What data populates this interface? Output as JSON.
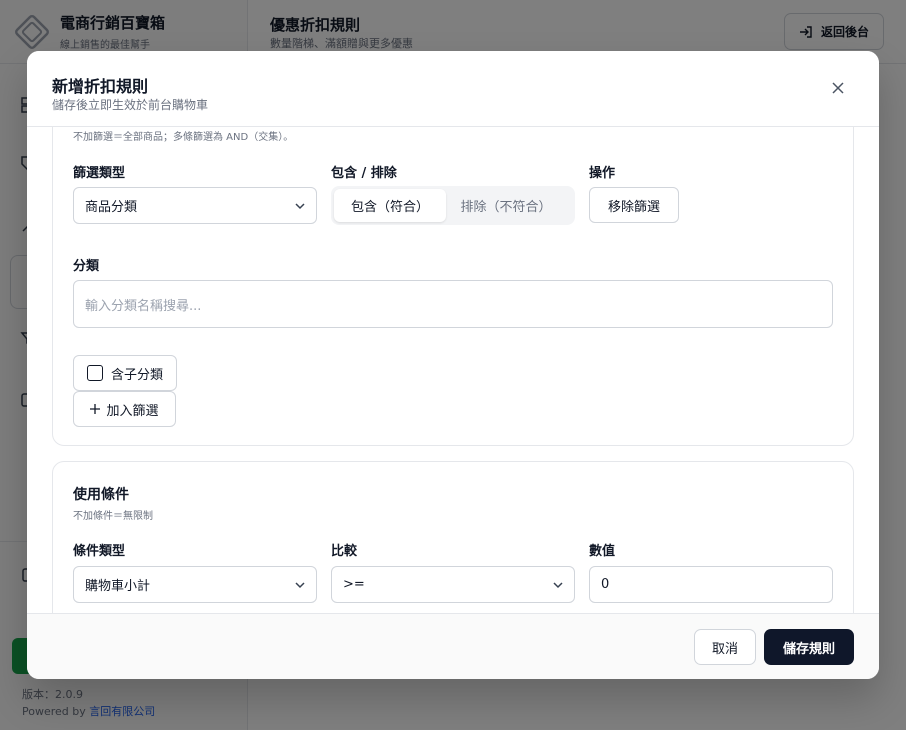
{
  "app": {
    "brand_title": "電商行銷百寶箱",
    "brand_subtitle": "線上銷售的最佳幫手",
    "page_title": "優惠折扣規則",
    "page_subtitle": "數量階梯、滿額贈與更多優惠",
    "back_button": "返回後台",
    "version": "版本：2.0.9",
    "powered_prefix": "Powered by ",
    "powered_company": "言回有限公司"
  },
  "modal": {
    "title": "新增折扣規則",
    "subtitle": "儲存後立即生效於前台購物車",
    "filters_hint": "不加篩選＝全部商品；多條篩選為 AND（交集）。",
    "filter_type_label": "篩選類型",
    "filter_type_value": "商品分類",
    "include_exclude_label": "包含 / 排除",
    "include_option": "包含（符合）",
    "exclude_option": "排除（不符合）",
    "actions_label": "操作",
    "remove_filter_button": "移除篩選",
    "category_label": "分類",
    "category_placeholder": "輸入分類名稱搜尋...",
    "include_children_label": "含子分類",
    "add_filter_button": "加入篩選",
    "conditions_title": "使用條件",
    "conditions_hint": "不加條件＝無限制",
    "condition_type_label": "條件類型",
    "condition_type_value": "購物車小計",
    "compare_label": "比較",
    "compare_value": ">=",
    "value_label": "數值",
    "value_value": "0",
    "cancel_button": "取消",
    "save_button": "儲存規則"
  },
  "colors": {
    "accent_dark": "#0f172a",
    "brand_green": "#16a34a",
    "link_blue": "#2563eb"
  }
}
